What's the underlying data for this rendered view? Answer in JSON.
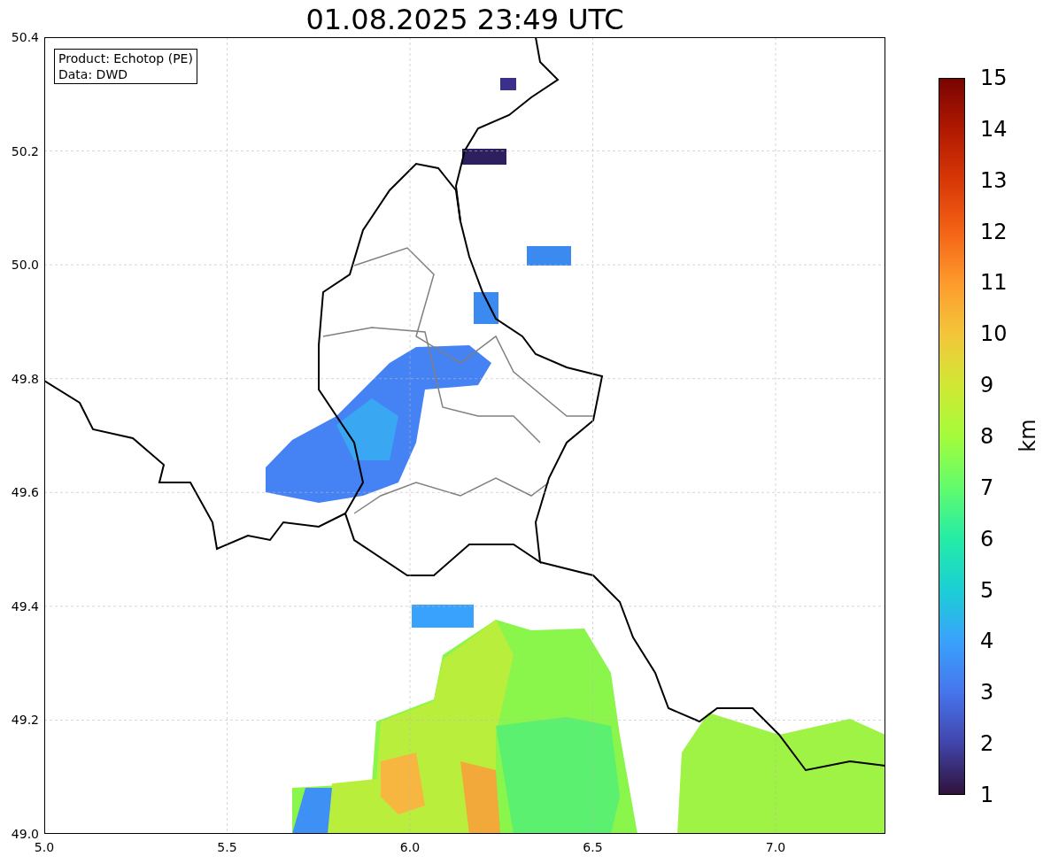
{
  "title": "01.08.2025 23:49 UTC",
  "info_box": [
    "Product: Echotop (PE)",
    "Data: DWD"
  ],
  "x_ticks": [
    "5.0",
    "5.5",
    "6.0",
    "6.5",
    "7.0"
  ],
  "y_ticks": [
    "50.4",
    "50.2",
    "50.0",
    "49.8",
    "49.6",
    "49.4",
    "49.2",
    "49.0"
  ],
  "colorbar": {
    "label": "km",
    "ticks": [
      "15",
      "14",
      "13",
      "12",
      "11",
      "10",
      "9",
      "8",
      "7",
      "6",
      "5",
      "4",
      "3",
      "2",
      "1"
    ]
  }
}
